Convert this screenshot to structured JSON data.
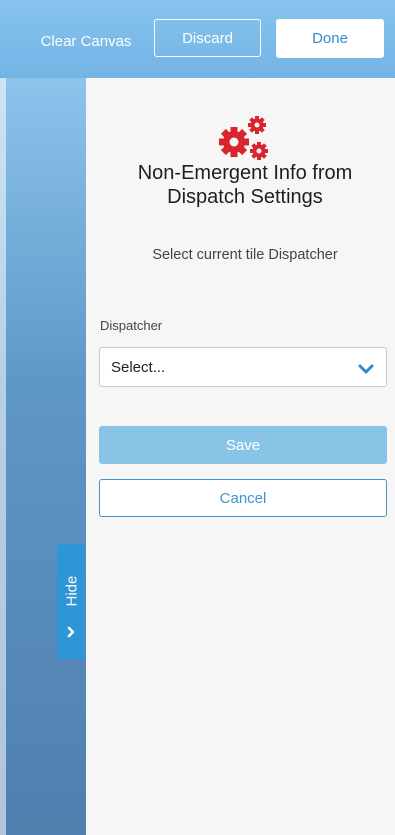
{
  "toolbar": {
    "clear_label": "Clear Canvas",
    "discard_label": "Discard",
    "done_label": "Done"
  },
  "panel": {
    "icon": "gears-icon",
    "title_line1": "Non-Emergent Info from",
    "title_line2": "Dispatch Settings",
    "subtitle": "Select current tile Dispatcher",
    "dispatcher": {
      "label": "Dispatcher",
      "value": "Select..."
    },
    "save_label": "Save",
    "cancel_label": "Cancel"
  },
  "sidebar": {
    "hide_label": "Hide"
  },
  "colors": {
    "accent": "#2e95d6",
    "gear_red": "#d9252f",
    "save_disabled": "#88c4e6"
  }
}
